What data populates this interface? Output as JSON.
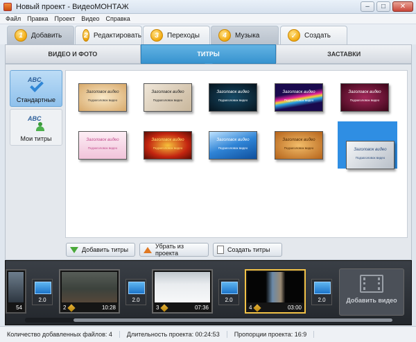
{
  "window": {
    "title": "Новый проект - ВидеоМОНТАЖ",
    "minimize": "–",
    "maximize": "□",
    "close": "✕"
  },
  "menu": [
    "Файл",
    "Правка",
    "Проект",
    "Видео",
    "Справка"
  ],
  "steps": [
    {
      "num": "1",
      "label": "Добавить",
      "active": true
    },
    {
      "num": "2",
      "label": "Редактировать",
      "active": false
    },
    {
      "num": "3",
      "label": "Переходы",
      "active": false
    },
    {
      "num": "4",
      "label": "Музыка",
      "active": false
    },
    {
      "num": "✓",
      "label": "Создать",
      "active": false
    }
  ],
  "subtabs": [
    {
      "label": "ВИДЕО И ФОТО",
      "active": false
    },
    {
      "label": "ТИТРЫ",
      "active": true
    },
    {
      "label": "ЗАСТАВКИ",
      "active": false
    }
  ],
  "sidebar": {
    "items": [
      {
        "label": "Стандартные",
        "icon": "abc-check-icon",
        "active": true
      },
      {
        "label": "Мои титры",
        "icon": "abc-user-icon",
        "active": false
      }
    ]
  },
  "titles": [
    {
      "t1": "Заголовок видео",
      "t2": "Подзаголовок видео",
      "bg": "#f3dcb0",
      "fg": "#333",
      "style": "parchment"
    },
    {
      "t1": "Заголовок видео",
      "t2": "Подзаголовок видео",
      "bg": "#e2d6c3",
      "fg": "#222",
      "style": "camera"
    },
    {
      "t1": "Заголовок видео",
      "t2": "Подзаголовок видео",
      "bg": "#0a2a3e",
      "fg": "#fff",
      "style": "dark-blue"
    },
    {
      "t1": "Заголовок видео",
      "t2": "Подзаголовок видео",
      "bg": "#1c0d52",
      "fg": "#fff",
      "style": "rainbow"
    },
    {
      "t1": "Заголовок видео",
      "t2": "Подзаголовок видео",
      "bg": "#6b1033",
      "fg": "#fff",
      "style": "burgundy"
    },
    {
      "t1": "Заголовок видео",
      "t2": "Подзаголовок видео",
      "bg": "#f8dbe8",
      "fg": "#c04a8a",
      "style": "pink"
    },
    {
      "t1": "Заголовок видео",
      "t2": "Подзаголовок видео",
      "bg": "#b41b0e",
      "fg": "#ffe070",
      "style": "fire"
    },
    {
      "t1": "Заголовок видео",
      "t2": "Подзаголовок видео",
      "bg": "#2d7fd0",
      "fg": "#fff",
      "style": "film-blue"
    },
    {
      "t1": "Заголовок видео",
      "t2": "Подзаголовок видео",
      "bg": "#d98a2b",
      "fg": "#4a2500",
      "style": "amber"
    },
    {
      "t1": "Заголовок видео",
      "t2": "Подзаголовок видео",
      "bg": "#d9dde2",
      "fg": "#2a4a7a",
      "style": "silver",
      "selected": true
    }
  ],
  "actions": {
    "add": "Добавить титры",
    "remove": "Убрать из проекта",
    "create": "Создать титры"
  },
  "timeline": {
    "partial_duration": "54",
    "clips": [
      {
        "num": "2",
        "duration": "10:28",
        "scene": "dark-field",
        "selected": false
      },
      {
        "num": "3",
        "duration": "07:36",
        "scene": "snow",
        "selected": false
      },
      {
        "num": "4",
        "duration": "03:00",
        "scene": "portrait",
        "selected": true
      }
    ],
    "transitions": [
      "2.0",
      "2.0",
      "2.0",
      "2.0"
    ],
    "add_video_label": "Добавить видео"
  },
  "status": {
    "files": "Количество добавленных файлов: 4",
    "duration": "Длительность проекта: 00:24:53",
    "ratio": "Пропорции проекта: 16:9"
  },
  "colors": {
    "accent": "#3793cf",
    "selection": "#2f8ee3",
    "step_badge": "#f2a90f",
    "clip_selected_border": "#f2c247"
  }
}
